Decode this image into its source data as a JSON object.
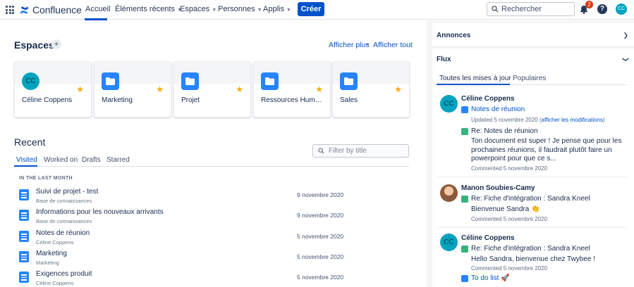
{
  "header": {
    "logo": "Confluence",
    "nav": [
      {
        "label": "Accueil"
      },
      {
        "label": "Éléments récents"
      },
      {
        "label": "Espaces"
      },
      {
        "label": "Personnes"
      },
      {
        "label": "Applis"
      }
    ],
    "create_label": "Créer",
    "search_placeholder": "Rechercher",
    "notifications_count": "2",
    "help_label": "?",
    "avatar_initials": "CC"
  },
  "spaces": {
    "title": "Espaces",
    "add_label": "+",
    "show_more": "Afficher plus",
    "separator": "•",
    "show_all": "Afficher tout",
    "items": [
      {
        "name": "Céline Coppens",
        "initials": "CC"
      },
      {
        "name": "Marketing"
      },
      {
        "name": "Projet"
      },
      {
        "name": "Ressources Humaines"
      },
      {
        "name": "Sales"
      }
    ]
  },
  "recent": {
    "title": "Recent",
    "filter_placeholder": "Filter by title",
    "tabs": [
      "Visited",
      "Worked on",
      "Drafts",
      "Starred"
    ],
    "section_label": "IN THE LAST MONTH",
    "items": [
      {
        "title": "Suivi de projet - test",
        "space": "Base de connaissances",
        "date": "9 novembre 2020"
      },
      {
        "title": "Informations pour les nouveaux arrivants",
        "space": "Base de connaissances",
        "date": "9 novembre 2020"
      },
      {
        "title": "Notes de réunion",
        "space": "Céline Coppens",
        "date": "5 novembre 2020"
      },
      {
        "title": "Marketing",
        "space": "Marketing",
        "date": "5 novembre 2020"
      },
      {
        "title": "Exigences produit",
        "space": "Céline Coppens",
        "date": "5 novembre 2020"
      }
    ]
  },
  "announcements": {
    "title": "Annonces"
  },
  "feed": {
    "title": "Flux",
    "tabs": [
      "Toutes les mises à jour",
      "Populaires"
    ],
    "entries": [
      {
        "user": "Céline Coppens",
        "initials": "CC",
        "doc": "Notes de réunion",
        "updated": "Updated 5 novembre 2020 (",
        "view_changes": "afficher les modifications",
        "updated_close": ")",
        "comment_title": "Re: Notes de réunion",
        "comment_body": "Ton document est super ! Je pense que pour les prochaines réunions, il faudrait plutôt faire un powerpoint pour que ce s...",
        "comment_meta": "Commented 5 novembre 2020"
      },
      {
        "user": "Manon Soubies-Camy",
        "comment_title": "Re: Fiche d'intégration : Sandra Kneel",
        "comment_body": "Bienvenue Sandra 👏",
        "comment_meta": "Commented 5 novembre 2020"
      },
      {
        "user": "Céline Coppens",
        "initials": "CC",
        "comment_title": "Re: Fiche d'intégration : Sandra Kneel",
        "comment_body": "Hello Sandra, bienvenue chez Twybee !",
        "comment_meta": "Commented 5 novembre 2020",
        "doc": "To do list 🚀"
      }
    ]
  },
  "colors": {
    "accent": "#0052cc",
    "space_icon": "#2684ff",
    "avatar": "#00a3bf",
    "star": "#ffab00",
    "comment_icon": "#36b37e",
    "badge": "#de350b"
  }
}
